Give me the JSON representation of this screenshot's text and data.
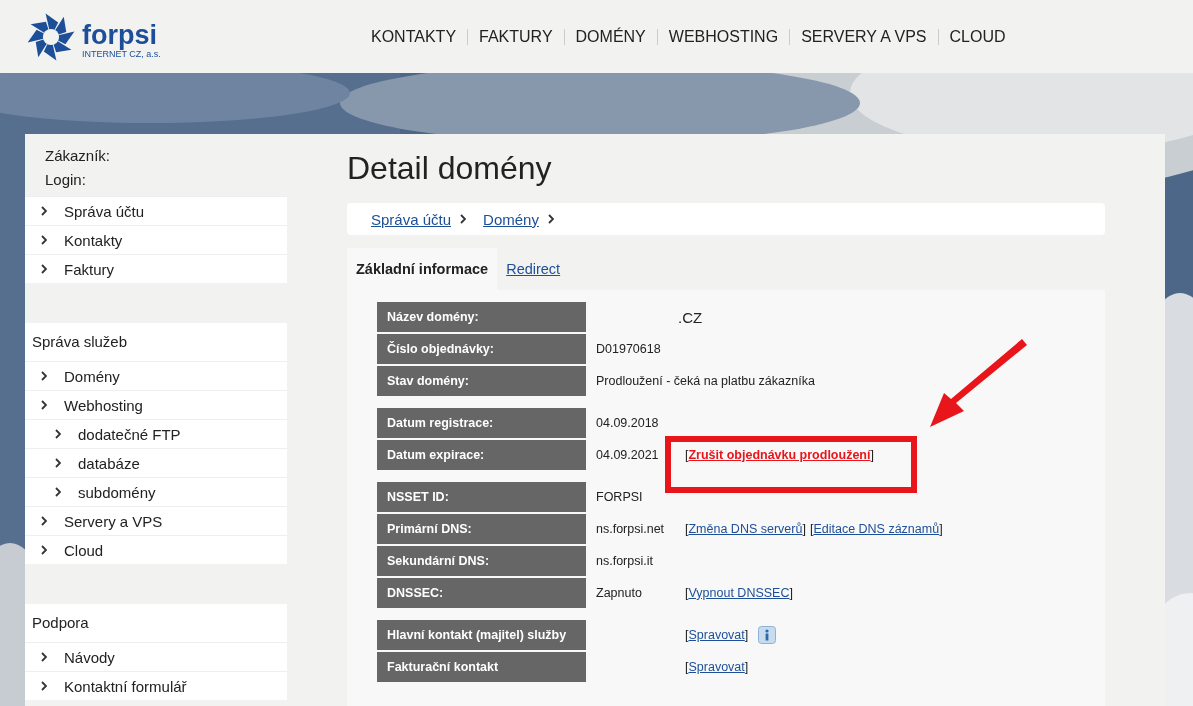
{
  "header": {
    "logo": {
      "name": "forpsi",
      "subtitle": "INTERNET CZ, a.s."
    },
    "nav": [
      "KONTAKTY",
      "FAKTURY",
      "DOMÉNY",
      "WEBHOSTING",
      "SERVERY A VPS",
      "CLOUD"
    ]
  },
  "sidebar": {
    "account": [
      "Zákazník:",
      "Login:"
    ],
    "sections": [
      {
        "items": [
          {
            "label": "Správa účtu"
          },
          {
            "label": "Kontakty"
          },
          {
            "label": "Faktury"
          }
        ]
      },
      {
        "title": "Správa služeb",
        "items": [
          {
            "label": "Domény"
          },
          {
            "label": "Webhosting",
            "children": [
              {
                "label": "dodatečné FTP"
              },
              {
                "label": "databáze"
              },
              {
                "label": "subdomény"
              }
            ]
          },
          {
            "label": "Servery a VPS"
          },
          {
            "label": "Cloud"
          }
        ]
      },
      {
        "title": "Podpora",
        "items": [
          {
            "label": "Návody"
          },
          {
            "label": "Kontaktní formulář"
          }
        ]
      }
    ]
  },
  "main": {
    "title": "Detail domény",
    "breadcrumbs": [
      "Správa účtu",
      "Domény"
    ],
    "tabs": [
      {
        "label": "Základní informace",
        "selected": true
      },
      {
        "label": "Redirect",
        "selected": false
      }
    ],
    "groups": [
      [
        {
          "label": "Název domény:",
          "value": ".CZ",
          "kind": "domain"
        },
        {
          "label": "Číslo objednávky:",
          "value": "D01970618"
        },
        {
          "label": "Stav domény:",
          "value": "Prodloužení - čeká na platbu zákazníka"
        }
      ],
      [
        {
          "label": "Datum registrace:",
          "value": "04.09.2018"
        },
        {
          "label": "Datum expirace:",
          "value": "04.09.2021",
          "actions": [
            {
              "left": "[",
              "text": "Zrušit objednávku prodloužení",
              "right": "]",
              "kind": "danger"
            }
          ]
        }
      ],
      [
        {
          "label": "NSSET ID:",
          "value": "FORPSI"
        },
        {
          "label": "Primární DNS:",
          "value": "ns.forpsi.net",
          "actions": [
            {
              "left": "[",
              "text": "Změna DNS serverů",
              "right": "]",
              "kind": "link"
            },
            {
              "left": "[",
              "text": "Editace DNS záznamů",
              "right": "]",
              "kind": "link"
            }
          ]
        },
        {
          "label": "Sekundární DNS:",
          "value": "ns.forpsi.it"
        },
        {
          "label": "DNSSEC:",
          "value": "Zapnuto",
          "actions": [
            {
              "left": "[",
              "text": "Vypnout DNSSEC",
              "right": "]",
              "kind": "link"
            }
          ]
        }
      ],
      [
        {
          "label": "Hlavní kontakt (majitel) služby",
          "actions": [
            {
              "left": "[",
              "text": "Spravovat",
              "right": "]",
              "kind": "link"
            }
          ],
          "info": true
        },
        {
          "label": "Fakturační kontakt",
          "actions": [
            {
              "left": "[",
              "text": "Spravovat",
              "right": "]",
              "kind": "link"
            }
          ]
        }
      ]
    ]
  }
}
